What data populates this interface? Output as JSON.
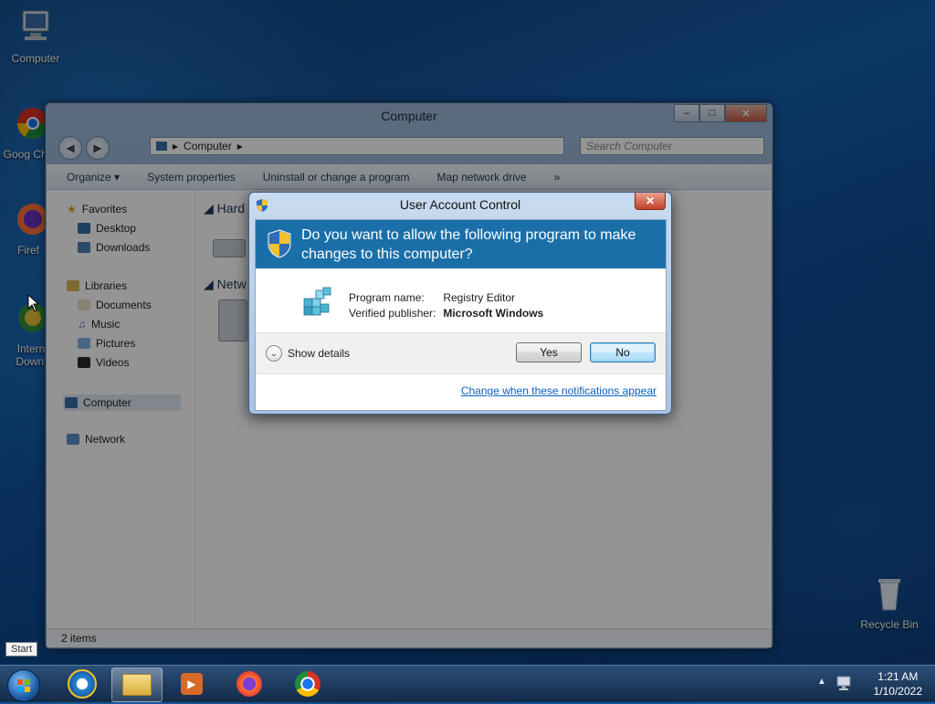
{
  "desktop": {
    "icons": [
      {
        "label": "Computer"
      },
      {
        "label": "Goog Chro"
      },
      {
        "label": "Firef"
      },
      {
        "label": "Intern Downl"
      },
      {
        "label": "Recycle Bin"
      }
    ]
  },
  "explorer": {
    "title": "Computer",
    "address": "Computer",
    "search_placeholder": "Search Computer",
    "toolbar": [
      "Organize ▾",
      "System properties",
      "Uninstall or change a program",
      "Map network drive",
      "»"
    ],
    "sidebar": {
      "favorites": "Favorites",
      "favorites_items": [
        "Desktop",
        "Downloads"
      ],
      "libraries": "Libraries",
      "libraries_items": [
        "Documents",
        "Music",
        "Pictures",
        "Videos"
      ],
      "computer": "Computer",
      "network": "Network"
    },
    "sections": [
      "Hard",
      "Netw"
    ],
    "status": "2 items"
  },
  "uac": {
    "title": "User Account Control",
    "close_label": "✕",
    "question": "Do you want to allow the following program to make changes to this computer?",
    "program_name_label": "Program name:",
    "program_name": "Registry Editor",
    "publisher_label": "Verified publisher:",
    "publisher": "Microsoft Windows",
    "show_details": "Show details",
    "yes": "Yes",
    "no": "No",
    "link": "Change when these notifications appear"
  },
  "taskbar": {
    "start_tooltip": "Start",
    "time": "1:21 AM",
    "date": "1/10/2022"
  },
  "colors": {
    "uac_banner": "#1b6fa9",
    "link": "#0b62c1",
    "taskbar": "#132a48"
  }
}
